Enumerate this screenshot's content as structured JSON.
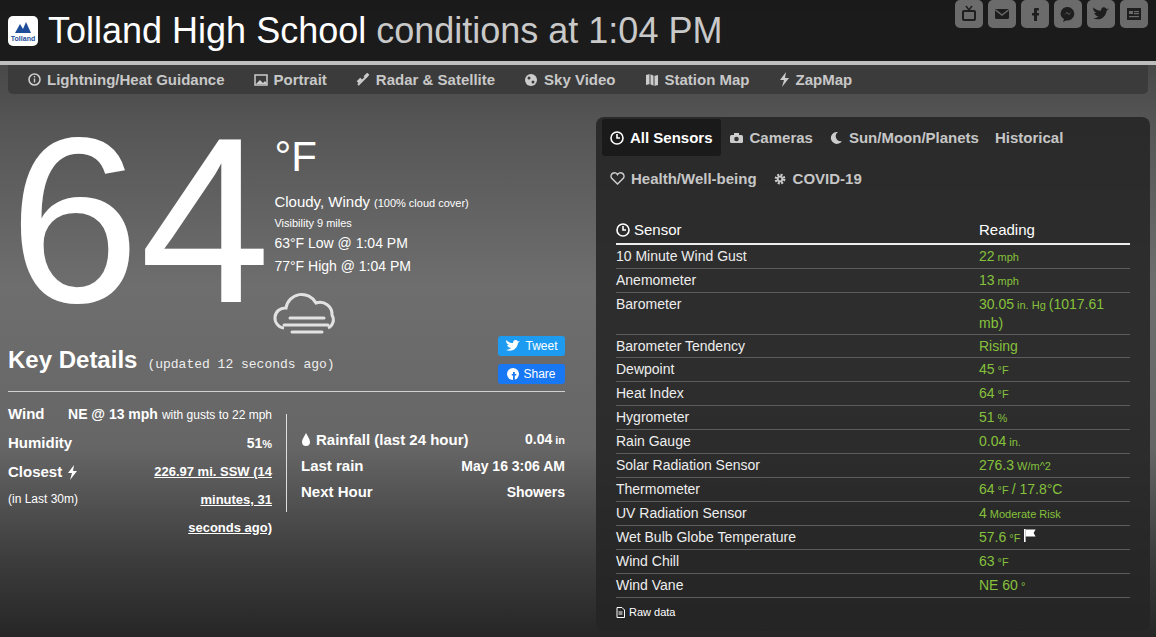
{
  "header": {
    "logo": "Tolland",
    "title": "Tolland High School",
    "subtitle": "conditions at 1:04 PM"
  },
  "nav": [
    "Lightning/Heat Guidance",
    "Portrait",
    "Radar & Satellite",
    "Sky Video",
    "Station Map",
    "ZapMap"
  ],
  "current": {
    "temperature": "64",
    "unit": "°F",
    "condition": "Cloudy, Windy",
    "cloud_cover": "(100% cloud cover)",
    "visibility": "Visibility 9 miles",
    "low": "63°F Low @ 1:04 PM",
    "high": "77°F High @ 1:04 PM"
  },
  "share_buttons": [
    "Tweet",
    "Share"
  ],
  "key_details": {
    "title": "Key Details",
    "updated": "(updated 12 seconds ago)",
    "wind": {
      "label": "Wind",
      "value": "NE @ 13 mph",
      "detail": "with gusts to 22 mph"
    },
    "humidity": {
      "label": "Humidity",
      "value": "51",
      "unit": "%"
    },
    "closest": {
      "label": "Closest",
      "note": "(in Last 30m)",
      "value": "226.97 mi. SSW (14 minutes, 31 seconds ago)"
    },
    "right": [
      {
        "label": "Rainfall (last 24 hour)",
        "value": "0.04",
        "unit": "in"
      },
      {
        "label": "Last rain",
        "value": "May 16 3:06 AM"
      },
      {
        "label": "Next Hour",
        "value": "Showers"
      }
    ]
  },
  "tabs": [
    {
      "label": "All Sensors",
      "selected": true
    },
    {
      "label": "Cameras",
      "selected": false
    },
    {
      "label": "Sun/Moon/Planets",
      "selected": false
    },
    {
      "label": "Historical",
      "selected": false
    },
    {
      "label": "Health/Well-being",
      "selected": false
    },
    {
      "label": "COVID-19",
      "selected": false
    }
  ],
  "table": {
    "columns": [
      "Sensor",
      "Reading"
    ],
    "rows": [
      {
        "sensor": "10 Minute Wind Gust",
        "value": "22",
        "unit": "mph",
        "flag": false
      },
      {
        "sensor": "Anemometer",
        "value": "13",
        "unit": "mph",
        "flag": false
      },
      {
        "sensor": "Barometer",
        "value": "30.05",
        "unit": "in. Hg",
        "extra": "(1017.61 mb)",
        "flag": false
      },
      {
        "sensor": "Barometer Tendency",
        "value": "Rising",
        "flag": false
      },
      {
        "sensor": "Dewpoint",
        "value": "45",
        "unit": "°F",
        "flag": false
      },
      {
        "sensor": "Heat Index",
        "value": "64",
        "unit": "°F",
        "flag": false
      },
      {
        "sensor": "Hygrometer",
        "value": "51",
        "unit": "%",
        "flag": false
      },
      {
        "sensor": "Rain Gauge",
        "value": "0.04",
        "unit": "in.",
        "flag": false
      },
      {
        "sensor": "Solar Radiation Sensor",
        "value": "276.3",
        "unit": "W/m^2",
        "flag": false
      },
      {
        "sensor": "Thermometer",
        "value": "64",
        "unit": "°F",
        "extra": "/ 17.8°C",
        "flag": false
      },
      {
        "sensor": "UV Radiation Sensor",
        "value": "4",
        "unit": "Moderate Risk",
        "flag": false
      },
      {
        "sensor": "Wet Bulb Globe Temperature",
        "value": "57.6",
        "unit": "°F",
        "flag": true
      },
      {
        "sensor": "Wind Chill",
        "value": "63",
        "unit": "°F",
        "flag": false
      },
      {
        "sensor": "Wind Vane",
        "value": "NE 60",
        "unit": "°",
        "flag": false
      }
    ]
  },
  "raw_data": "Raw data"
}
